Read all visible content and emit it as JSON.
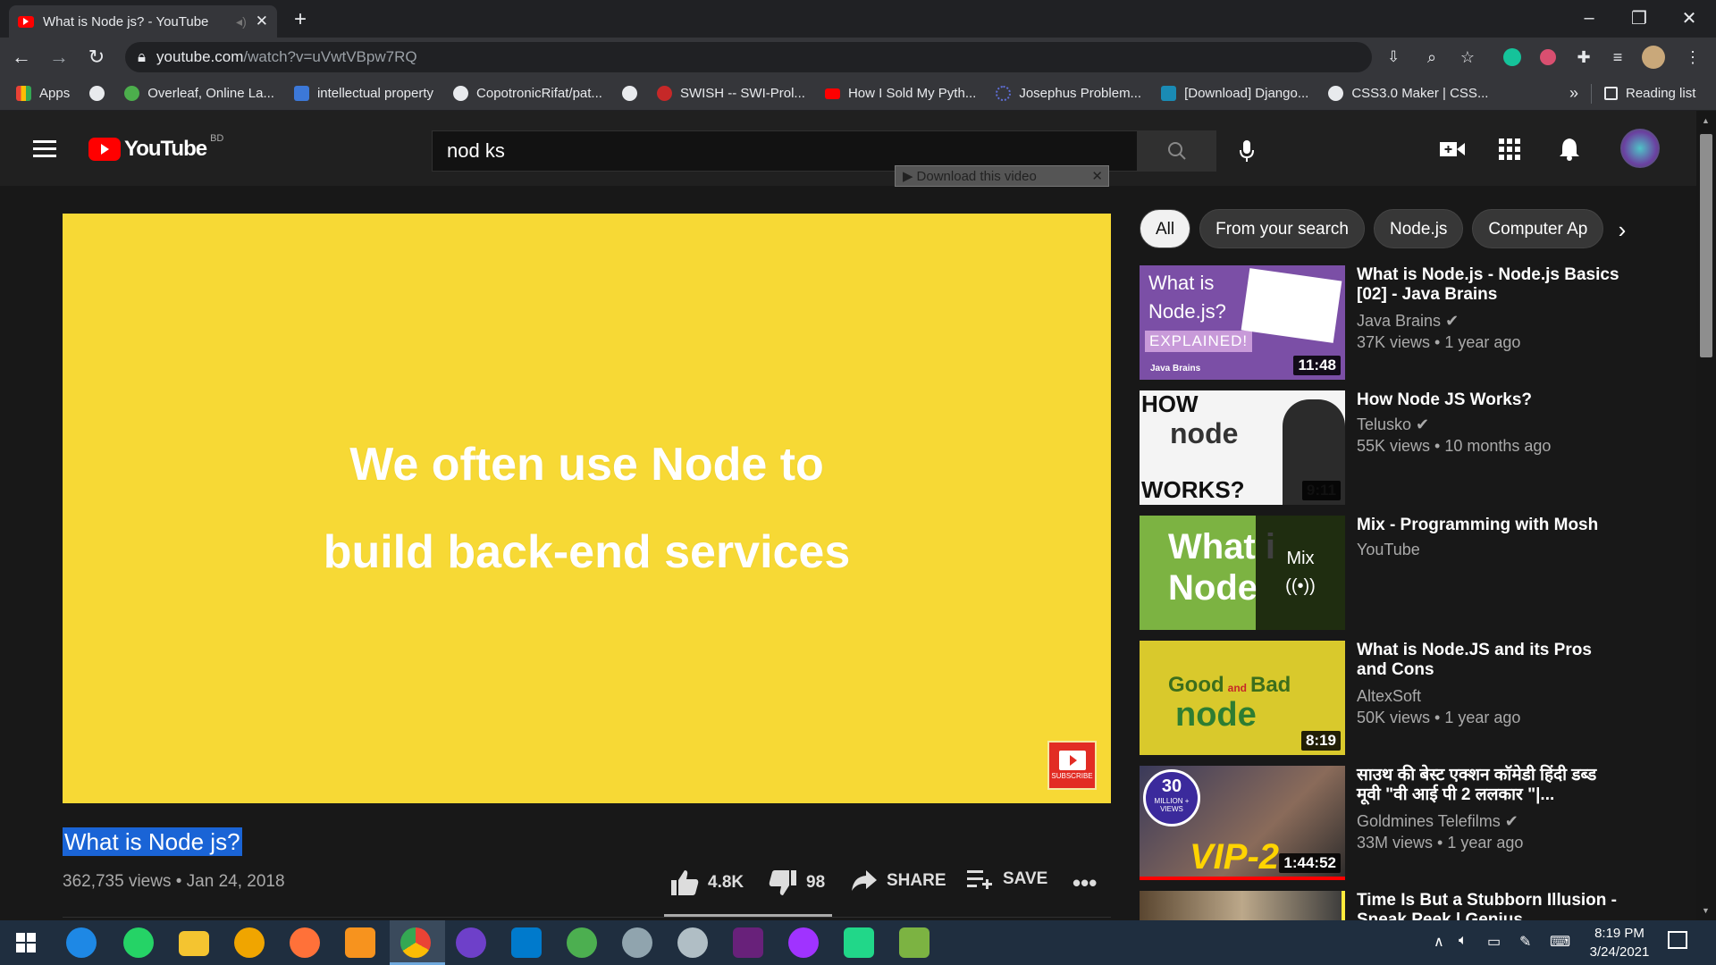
{
  "browser": {
    "tab_title": "What is Node js? - YouTube",
    "url_host": "youtube.com",
    "url_path": "/watch?v=uVwtVBpw7RQ",
    "new_tab_symbol": "+"
  },
  "bookmarks": {
    "items": [
      {
        "label": "Apps",
        "color": "#e94235"
      },
      {
        "label": "",
        "color": "#e8eaed"
      },
      {
        "label": "Overleaf, Online La...",
        "color": "#4cae4c"
      },
      {
        "label": "intellectual property",
        "color": "#3c78d8"
      },
      {
        "label": "CopotronicRifat/pat...",
        "color": "#e8eaed"
      },
      {
        "label": "",
        "color": "#e8eaed"
      },
      {
        "label": "SWISH -- SWI-Prol...",
        "color": "#c62828"
      },
      {
        "label": "How I Sold My Pyth...",
        "color": "#ff0000"
      },
      {
        "label": "Josephus Problem...",
        "color": "#5f6fd8"
      },
      {
        "label": "[Download] Django...",
        "color": "#1a8bb5"
      },
      {
        "label": "CSS3.0 Maker | CSS...",
        "color": "#e8eaed"
      }
    ],
    "overflow": "»",
    "reading_list": "Reading list"
  },
  "youtube": {
    "logo_text": "YouTube",
    "region": "BD",
    "search_value": "nod ks",
    "download_bar": "Download this video",
    "player_line1": "We often use Node to",
    "player_line2": "build back-end services",
    "subscribe_label": "SUBSCRIBE",
    "video_title": "What is Node js?",
    "video_meta": "362,735 views • Jan 24, 2018",
    "likes": "4.8K",
    "dislikes": "98",
    "share": "SHARE",
    "save": "SAVE",
    "chips": [
      "All",
      "From your search",
      "Node.js",
      "Computer Ap"
    ],
    "recommendations": [
      {
        "title": "What is Node.js - Node.js Basics [02] - Java Brains",
        "channel": "Java Brains",
        "verified": true,
        "views": "37K views • 1 year ago",
        "duration": "11:48",
        "thumb_text_1": "What is",
        "thumb_text_2": "Node.js?",
        "thumb_text_3": "EXPLAINED!",
        "thumb_text_4": "Java Brains"
      },
      {
        "title": "How Node JS Works?",
        "channel": "Telusko",
        "verified": true,
        "views": "55K views • 10 months ago",
        "duration": "9:11",
        "thumb_text_1": "HOW",
        "thumb_text_2": "node",
        "thumb_text_3": "WORKS?"
      },
      {
        "title": "Mix - Programming with Mosh",
        "channel": "YouTube",
        "verified": false,
        "views": "",
        "duration": "",
        "thumb_text_1": "What i",
        "thumb_text_2": "Node",
        "mix_label": "Mix"
      },
      {
        "title": "What is Node.JS and its Pros and Cons",
        "channel": "AltexSoft",
        "verified": false,
        "views": "50K views • 1 year ago",
        "duration": "8:19",
        "thumb_text_1": "Good",
        "thumb_text_2": "and",
        "thumb_text_3": "Bad",
        "thumb_text_4": "node"
      },
      {
        "title": "साउथ की बेस्ट एक्शन कॉमेडी हिंदी डब्ड मूवी \"वी आई पी 2 ललकार \"|...",
        "channel": "Goldmines Telefilms",
        "verified": true,
        "views": "33M views • 1 year ago",
        "duration": "1:44:52",
        "thumb_text_1": "30",
        "thumb_text_2": "MILLION + VIEWS",
        "thumb_text_3": "VIP-2"
      },
      {
        "title": "Time Is But a Stubborn Illusion - Sneak Peek | Genius",
        "channel": "",
        "verified": false,
        "views": "",
        "duration": ""
      }
    ]
  },
  "taskbar": {
    "time": "8:19 PM",
    "date": "3/24/2021"
  },
  "colors": {
    "accent": "#ff0000",
    "player_bg": "#f7d935",
    "selection": "#1a64d6"
  }
}
